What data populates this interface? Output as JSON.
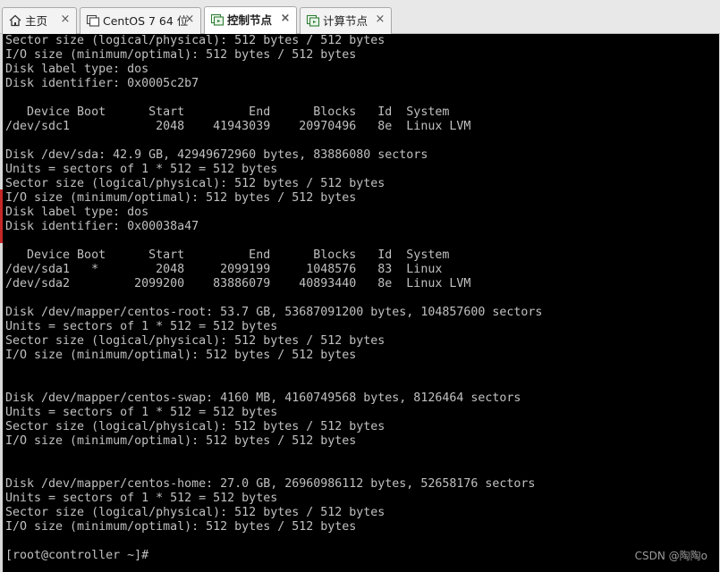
{
  "tabs": [
    {
      "label": "主页",
      "icon": "home-icon",
      "active": false
    },
    {
      "label": "CentOS 7 64 位",
      "icon": "vm-icon",
      "active": false
    },
    {
      "label": "控制节点",
      "icon": "vm-icon",
      "active": true
    },
    {
      "label": "计算节点",
      "icon": "vm-icon",
      "active": false
    }
  ],
  "tab_close_glyph": "×",
  "terminal": {
    "lines": [
      "Sector size (logical/physical): 512 bytes / 512 bytes",
      "I/O size (minimum/optimal): 512 bytes / 512 bytes",
      "Disk label type: dos",
      "Disk identifier: 0x0005c2b7",
      "",
      "   Device Boot      Start         End      Blocks   Id  System",
      "/dev/sdc1            2048    41943039    20970496   8e  Linux LVM",
      "",
      "Disk /dev/sda: 42.9 GB, 42949672960 bytes, 83886080 sectors",
      "Units = sectors of 1 * 512 = 512 bytes",
      "Sector size (logical/physical): 512 bytes / 512 bytes",
      "I/O size (minimum/optimal): 512 bytes / 512 bytes",
      "Disk label type: dos",
      "Disk identifier: 0x00038a47",
      "",
      "   Device Boot      Start         End      Blocks   Id  System",
      "/dev/sda1   *        2048     2099199     1048576   83  Linux",
      "/dev/sda2         2099200    83886079    40893440   8e  Linux LVM",
      "",
      "Disk /dev/mapper/centos-root: 53.7 GB, 53687091200 bytes, 104857600 sectors",
      "Units = sectors of 1 * 512 = 512 bytes",
      "Sector size (logical/physical): 512 bytes / 512 bytes",
      "I/O size (minimum/optimal): 512 bytes / 512 bytes",
      "",
      "",
      "Disk /dev/mapper/centos-swap: 4160 MB, 4160749568 bytes, 8126464 sectors",
      "Units = sectors of 1 * 512 = 512 bytes",
      "Sector size (logical/physical): 512 bytes / 512 bytes",
      "I/O size (minimum/optimal): 512 bytes / 512 bytes",
      "",
      "",
      "Disk /dev/mapper/centos-home: 27.0 GB, 26960986112 bytes, 52658176 sectors",
      "Units = sectors of 1 * 512 = 512 bytes",
      "Sector size (logical/physical): 512 bytes / 512 bytes",
      "I/O size (minimum/optimal): 512 bytes / 512 bytes",
      "",
      "[root@controller ~]#"
    ]
  },
  "watermark": "CSDN @陶陶o",
  "colors": {
    "terminal_bg": "#000000",
    "terminal_fg": "#c0c0c0",
    "tabbar_bg": "#e8e8e8"
  }
}
